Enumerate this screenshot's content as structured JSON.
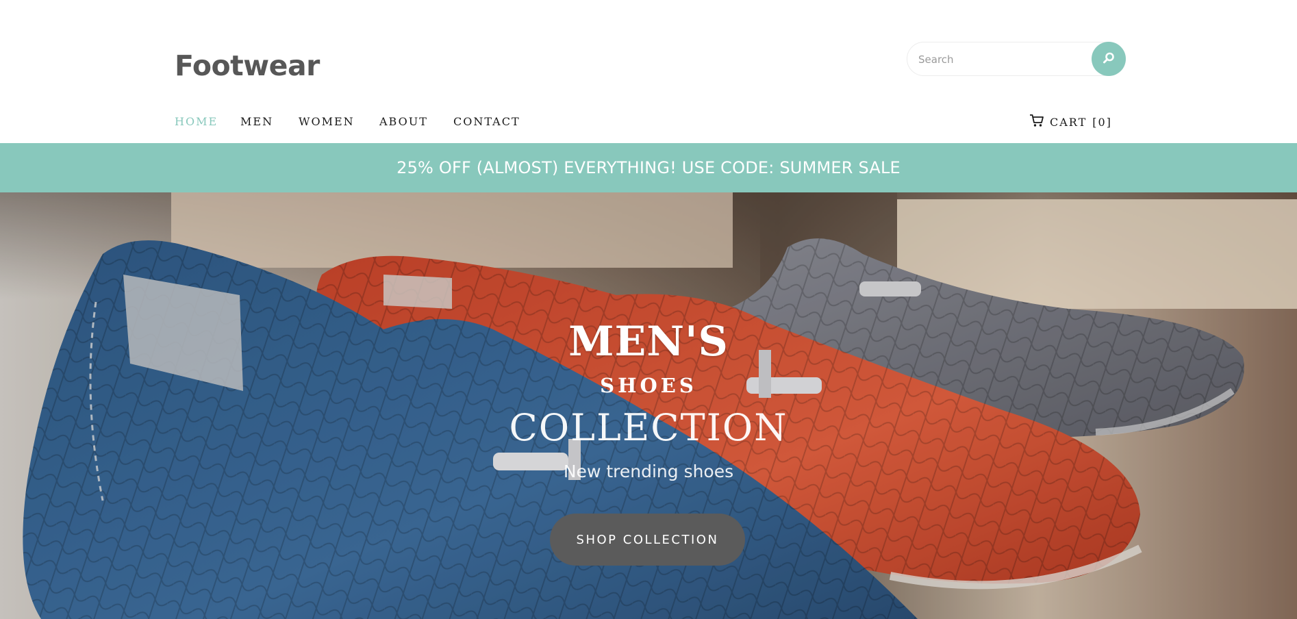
{
  "header": {
    "logo": "Footwear",
    "search": {
      "placeholder": "Search",
      "icon": "search-icon"
    },
    "nav": [
      {
        "label": "HOME",
        "active": true
      },
      {
        "label": "MEN",
        "active": false
      },
      {
        "label": "WOMEN",
        "active": false
      },
      {
        "label": "ABOUT",
        "active": false
      },
      {
        "label": "CONTACT",
        "active": false
      }
    ],
    "cart": {
      "label": "CART",
      "count_text": "[0]",
      "icon": "cart-icon"
    }
  },
  "promo": {
    "text": "25% OFF (ALMOST) EVERYTHING! USE CODE: SUMMER SALE"
  },
  "hero": {
    "title": "MEN'S",
    "subtitle": "SHOES",
    "collection": "COLLECTION",
    "tagline": "New trending shoes",
    "button_label": "SHOP COLLECTION"
  },
  "colors": {
    "accent": "#88c8bc",
    "logo": "#575757",
    "nav_text": "#1a1a1a",
    "hero_button": "#5b5b5b"
  }
}
